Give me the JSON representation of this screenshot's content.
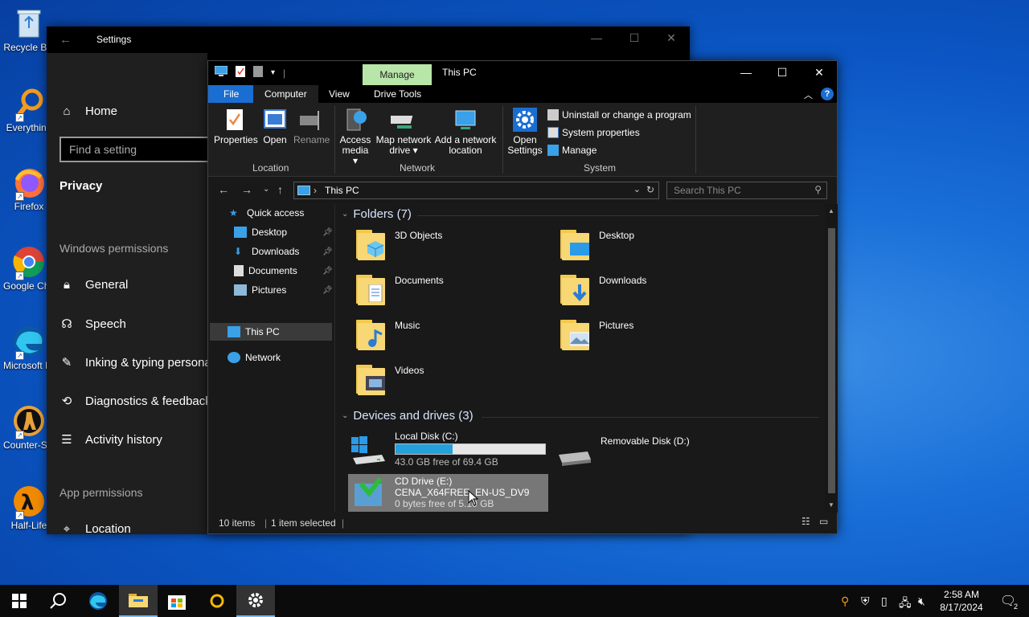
{
  "desktop_icons": [
    {
      "label": "Recycle Bin",
      "icon": "recycle-bin-icon"
    },
    {
      "label": "Everything",
      "icon": "search-icon"
    },
    {
      "label": "Firefox",
      "icon": "firefox-icon"
    },
    {
      "label": "Google Chrome",
      "icon": "chrome-icon"
    },
    {
      "label": "Microsoft Edge",
      "icon": "edge-icon"
    },
    {
      "label": "Counter-Strike Source",
      "icon": "counter-strike-icon"
    },
    {
      "label": "Half-Life",
      "icon": "half-life-icon",
      "badge": "2"
    }
  ],
  "settings": {
    "title": "Settings",
    "home": "Home",
    "search_placeholder": "Find a setting",
    "section": "Privacy",
    "windows_permissions": "Windows permissions",
    "items": [
      {
        "label": "General",
        "icon": "lock-icon"
      },
      {
        "label": "Speech",
        "icon": "speech-icon"
      },
      {
        "label": "Inking & typing personal",
        "icon": "inking-icon"
      },
      {
        "label": "Diagnostics & feedback",
        "icon": "diagnostics-icon"
      },
      {
        "label": "Activity history",
        "icon": "activity-history-icon"
      }
    ],
    "app_permissions": "App permissions",
    "app_items": [
      {
        "label": "Location",
        "icon": "location-icon"
      }
    ]
  },
  "explorer": {
    "title": "This PC",
    "contextual_tab": "Manage",
    "tabs": {
      "file": "File",
      "computer": "Computer",
      "view": "View",
      "drive_tools": "Drive Tools"
    },
    "ribbon": {
      "location": {
        "label": "Location",
        "buttons": [
          "Properties",
          "Open",
          "Rename"
        ]
      },
      "network": {
        "label": "Network",
        "access_media": [
          "Access",
          "media ▾"
        ],
        "map_network": [
          "Map network",
          "drive ▾"
        ],
        "add_network": [
          "Add a network",
          "location"
        ]
      },
      "system": {
        "label": "System",
        "open_settings": [
          "Open",
          "Settings"
        ],
        "uninstall": "Uninstall or change a program",
        "system_properties": "System properties",
        "manage": "Manage"
      }
    },
    "address": "This PC",
    "search_placeholder": "Search This PC",
    "nav": {
      "quick_access": "Quick access",
      "quick_items": [
        "Desktop",
        "Downloads",
        "Documents",
        "Pictures"
      ],
      "this_pc": "This PC",
      "network": "Network"
    },
    "folders_header": "Folders (7)",
    "folders": [
      "3D Objects",
      "Desktop",
      "Documents",
      "Downloads",
      "Music",
      "Pictures",
      "Videos"
    ],
    "devices_header": "Devices and drives (3)",
    "drives": [
      {
        "name": "Local Disk (C:)",
        "free": "43.0 GB free of 69.4 GB",
        "used_fraction": 0.38
      },
      {
        "name": "Removable Disk (D:)"
      },
      {
        "name": "CD Drive (E:)",
        "label": "CENA_X64FREE_EN-US_DV9",
        "free": "0 bytes free of 5.10 GB"
      }
    ],
    "status": {
      "items": "10 items",
      "selected": "1 item selected"
    }
  },
  "taskbar": {
    "time": "2:58 AM",
    "date": "8/17/2024",
    "notifications": "2"
  }
}
